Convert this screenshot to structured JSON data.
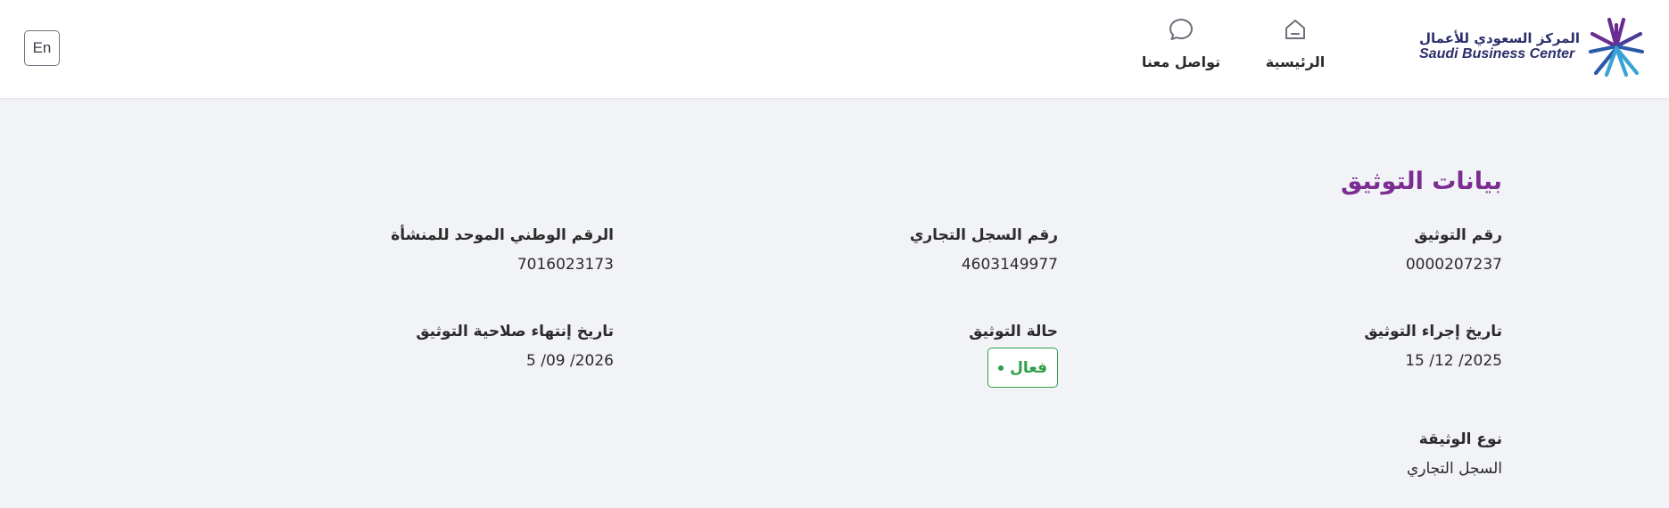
{
  "header": {
    "logo": {
      "name_ar": "المركز السعودي للأعمال",
      "name_en": "Saudi Business Center",
      "colors": {
        "purple": "#6a2c91",
        "blue": "#2b5aa8",
        "cyan": "#3aa3d6",
        "navy": "#2b2f6b"
      }
    },
    "nav": {
      "home": {
        "label": "الرئيسية",
        "icon": "home-icon"
      },
      "contact": {
        "label": "تواصل معنا",
        "icon": "chat-bubble-icon"
      }
    },
    "language_button": {
      "label": "En"
    }
  },
  "section": {
    "title": "بيانات التوثيق"
  },
  "fields": {
    "authentication_number": {
      "label": "رقم التوثيق",
      "value": "0000207237"
    },
    "commercial_register_number": {
      "label": "رقم السجل التجاري",
      "value": "4603149977"
    },
    "unified_national_number": {
      "label": "الرقم الوطني الموحد للمنشأة",
      "value": "7016023173"
    },
    "authentication_date": {
      "label": "تاريخ إجراء التوثيق",
      "value": "15 /12 /2025"
    },
    "authentication_status": {
      "label": "حالة التوثيق",
      "value": "فعال",
      "color": "#2e9e48"
    },
    "expiry_date": {
      "label": "تاريخ إنتهاء صلاحية التوثيق",
      "value": "5 /09 /2026"
    },
    "document_type": {
      "label": "نوع الوثيقة",
      "value": "السجل التجاري"
    }
  },
  "colors": {
    "title_purple": "#7b2d92",
    "background": "#f2f3f7",
    "status_green": "#2e9e48"
  }
}
